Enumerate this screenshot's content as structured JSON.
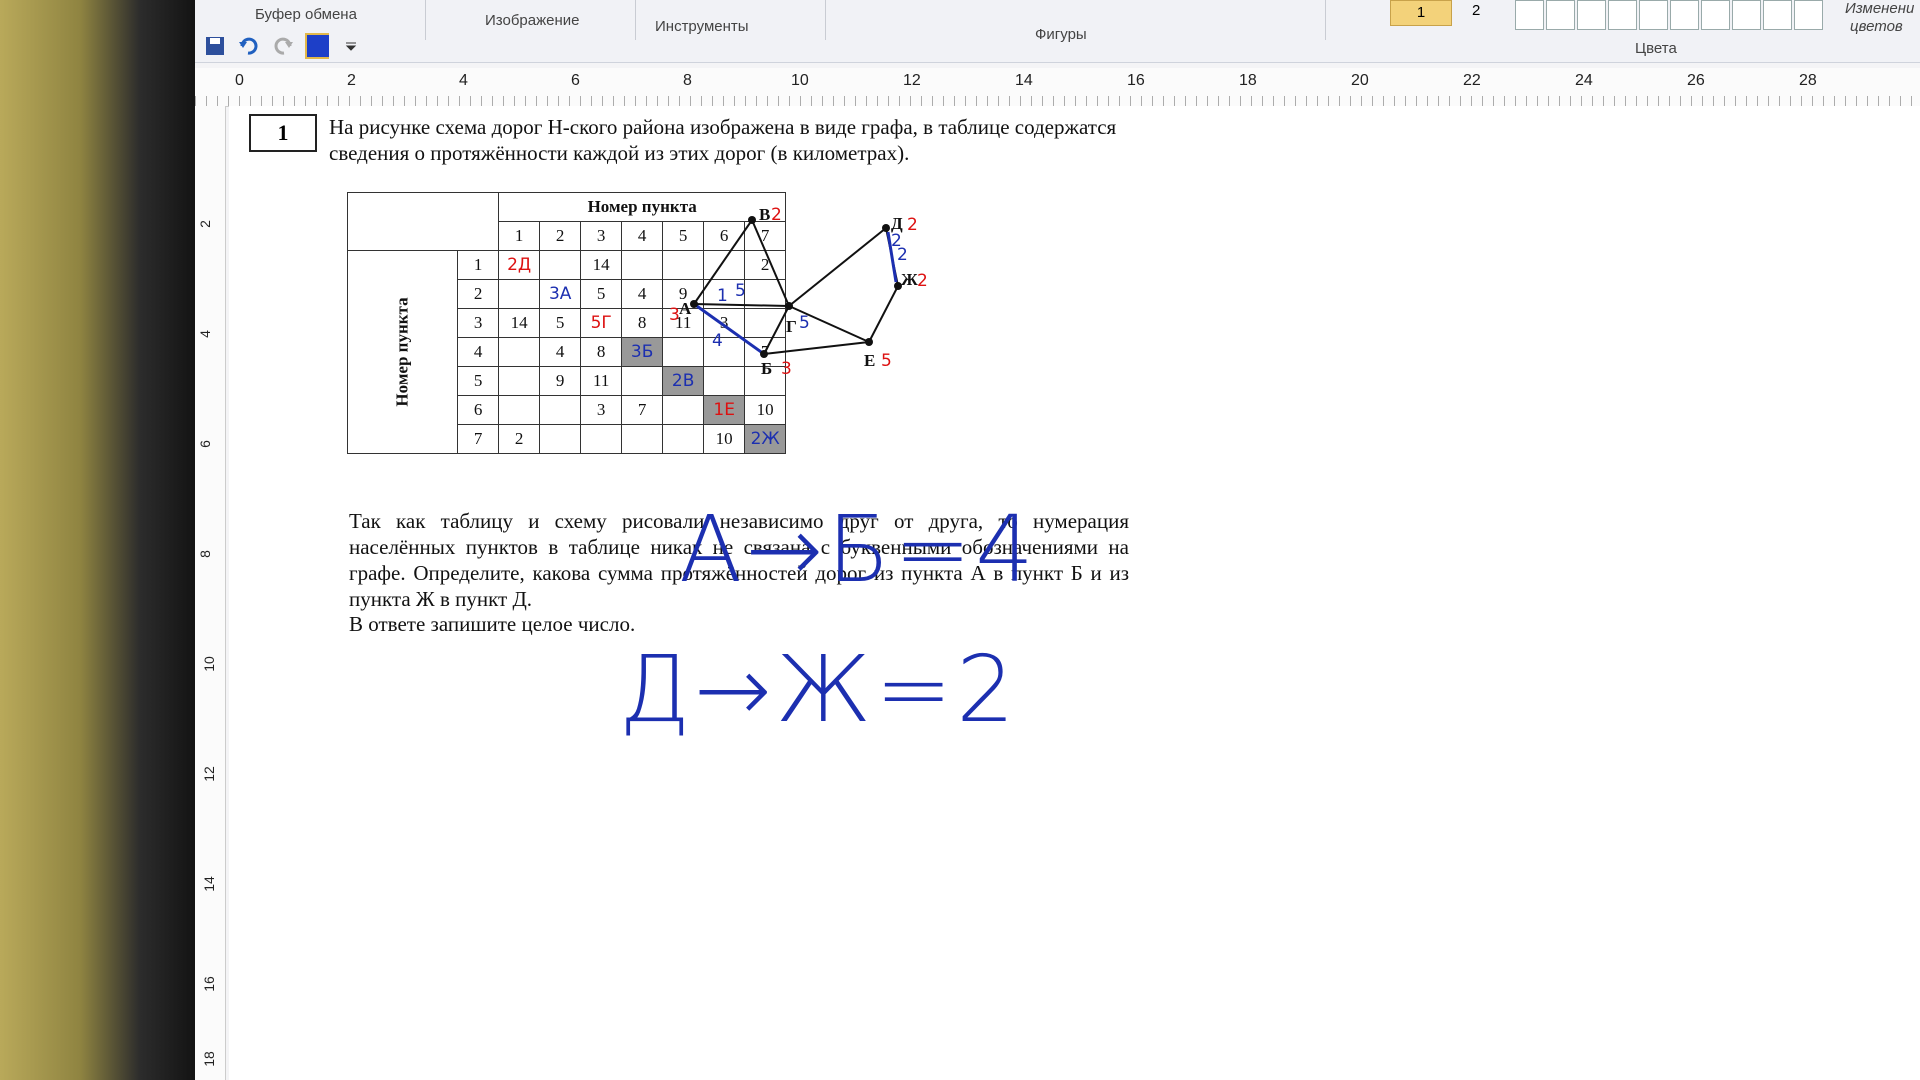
{
  "ribbon": {
    "groups": [
      "Буфер обмена",
      "Изображение",
      "Инструменты",
      "Фигуры",
      "Цвета"
    ],
    "color1_label": "1",
    "color2_label": "2",
    "right_label_line1": "Изменени",
    "right_label_line2": "цветов"
  },
  "ruler": {
    "marks": [
      "0",
      "2",
      "4",
      "6",
      "8",
      "10",
      "12",
      "14",
      "16",
      "18",
      "20",
      "22",
      "24",
      "26",
      "28"
    ],
    "vmarks": [
      "2",
      "4",
      "6",
      "8",
      "10",
      "12",
      "14",
      "16",
      "18"
    ]
  },
  "task": {
    "number": "1",
    "intro": "На рисунке схема дорог Н-ского района изображена в виде графа, в таблице содержатся сведения о протяжённости каждой из этих дорог (в километрах).",
    "body": "Так как таблицу и схему рисовали независимо друг от друга, то нумерация населённых пунктов в таблице никак не связана с буквенными обозначениями на графе. Определите, какова сумма протяжённостей дорог из пункта А в пункт Б и из пункта Ж в пункт Д.",
    "answer_hint": "В ответе запишите целое число."
  },
  "table": {
    "header_top": "Номер пункта",
    "header_side": "Номер пункта",
    "columns": [
      "1",
      "2",
      "3",
      "4",
      "5",
      "6",
      "7"
    ],
    "rows": [
      {
        "label": "1",
        "cells": [
          "",
          "",
          "14",
          "",
          "",
          "",
          "2"
        ]
      },
      {
        "label": "2",
        "cells": [
          "",
          "",
          "5",
          "4",
          "9",
          "",
          ""
        ]
      },
      {
        "label": "3",
        "cells": [
          "14",
          "5",
          "",
          "8",
          "11",
          "3",
          ""
        ]
      },
      {
        "label": "4",
        "cells": [
          "",
          "4",
          "8",
          "",
          "",
          "",
          "7"
        ]
      },
      {
        "label": "5",
        "cells": [
          "",
          "9",
          "11",
          "",
          "",
          "",
          ""
        ]
      },
      {
        "label": "6",
        "cells": [
          "",
          "",
          "3",
          "7",
          "",
          "",
          "10"
        ]
      },
      {
        "label": "7",
        "cells": [
          "2",
          "",
          "",
          "",
          "",
          "10",
          ""
        ]
      }
    ],
    "annotations": [
      "2Д",
      "3А",
      "5Г",
      "3Б",
      "2В",
      "1Е",
      "2Ж"
    ]
  },
  "graph": {
    "nodes": [
      "В",
      "Д",
      "Ж",
      "А",
      "Г",
      "Б",
      "Е"
    ],
    "annotations": [
      "2",
      "2",
      "2",
      "2",
      "3",
      "5",
      "5",
      "3",
      "1",
      "4",
      "5",
      "2"
    ]
  },
  "handwriting": {
    "line1": "А→Б=4",
    "line2": "Д→Ж=2"
  }
}
